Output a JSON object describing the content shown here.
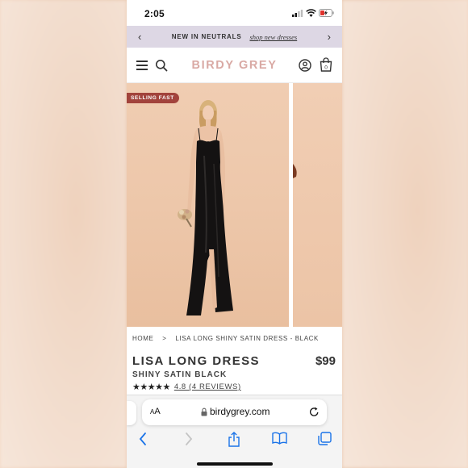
{
  "status": {
    "time": "2:05"
  },
  "promo": {
    "text": "NEW IN NEUTRALS",
    "link": "shop new dresses"
  },
  "header": {
    "logo": "BIRDY GREY",
    "bag_count": "0"
  },
  "gallery": {
    "badge": "SELLING FAST"
  },
  "breadcrumb": {
    "home": "HOME",
    "separator": ">",
    "current": "LISA LONG SHINY SATIN DRESS - BLACK"
  },
  "product": {
    "title": "LISA LONG DRESS",
    "price": "$99",
    "subtitle": "SHINY SATIN BLACK",
    "stars": "★★★★★",
    "rating_text": "4.8 (4 REVIEWS)",
    "rating_value": 4.8
  },
  "browser": {
    "aa_small": "A",
    "aa_large": "A",
    "url": "birdygrey.com"
  },
  "colors": {
    "accent": "#d9a9a4",
    "badge": "#a2433c",
    "promo_bg": "#ddd7e4",
    "ios_blue": "#1a73e8"
  }
}
